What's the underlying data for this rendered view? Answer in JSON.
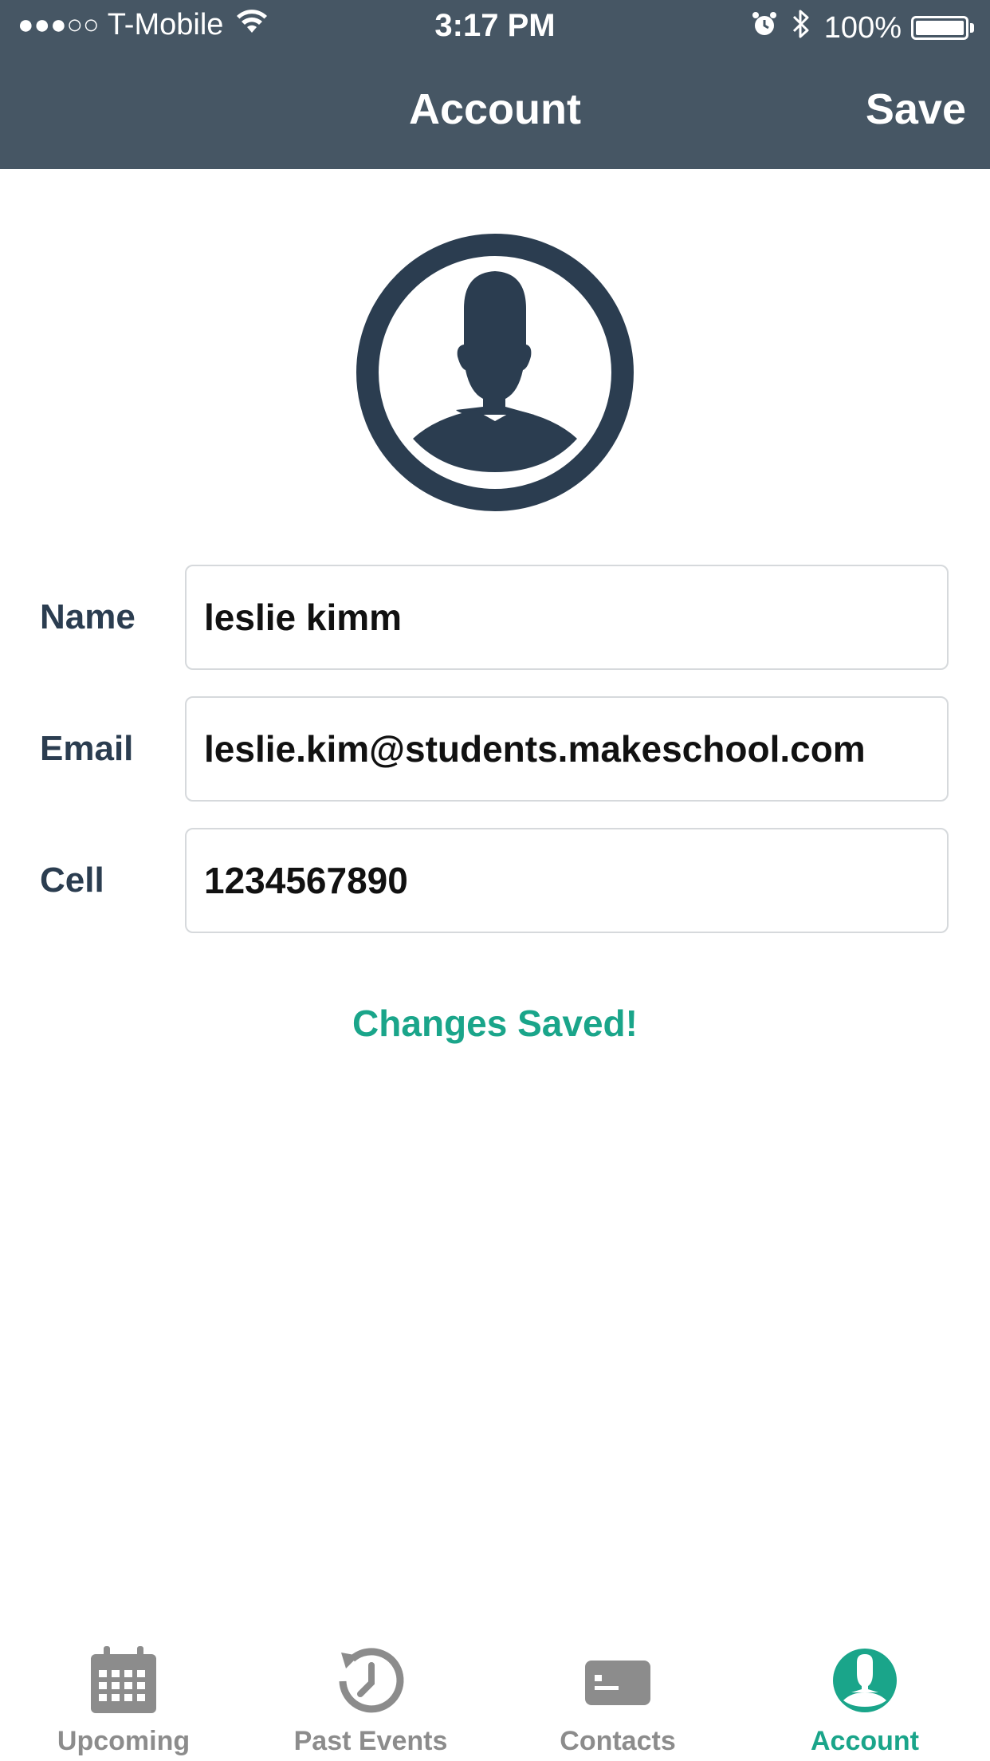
{
  "status_bar": {
    "signal": "●●●○○",
    "carrier": "T-Mobile",
    "time": "3:17 PM",
    "battery": "100%",
    "icons": [
      "wifi-icon",
      "alarm-icon",
      "bluetooth-icon",
      "battery-icon"
    ]
  },
  "nav": {
    "title": "Account",
    "save_label": "Save"
  },
  "form": {
    "name_label": "Name",
    "name_value": "leslie kimm",
    "email_label": "Email",
    "email_value": "leslie.kim@students.makeschool.com",
    "cell_label": "Cell",
    "cell_value": "1234567890"
  },
  "status_message": "Changes Saved!",
  "tabs": [
    {
      "label": "Upcoming",
      "icon": "calendar-icon",
      "active": false
    },
    {
      "label": "Past Events",
      "icon": "history-icon",
      "active": false
    },
    {
      "label": "Contacts",
      "icon": "contact-card-icon",
      "active": false
    },
    {
      "label": "Account",
      "icon": "account-icon",
      "active": true
    }
  ],
  "colors": {
    "nav_background": "#465664",
    "accent": "#1aa58a",
    "label_text": "#2b3d50",
    "inactive_tab": "#8c8c8c",
    "avatar": "#2b3d50"
  }
}
